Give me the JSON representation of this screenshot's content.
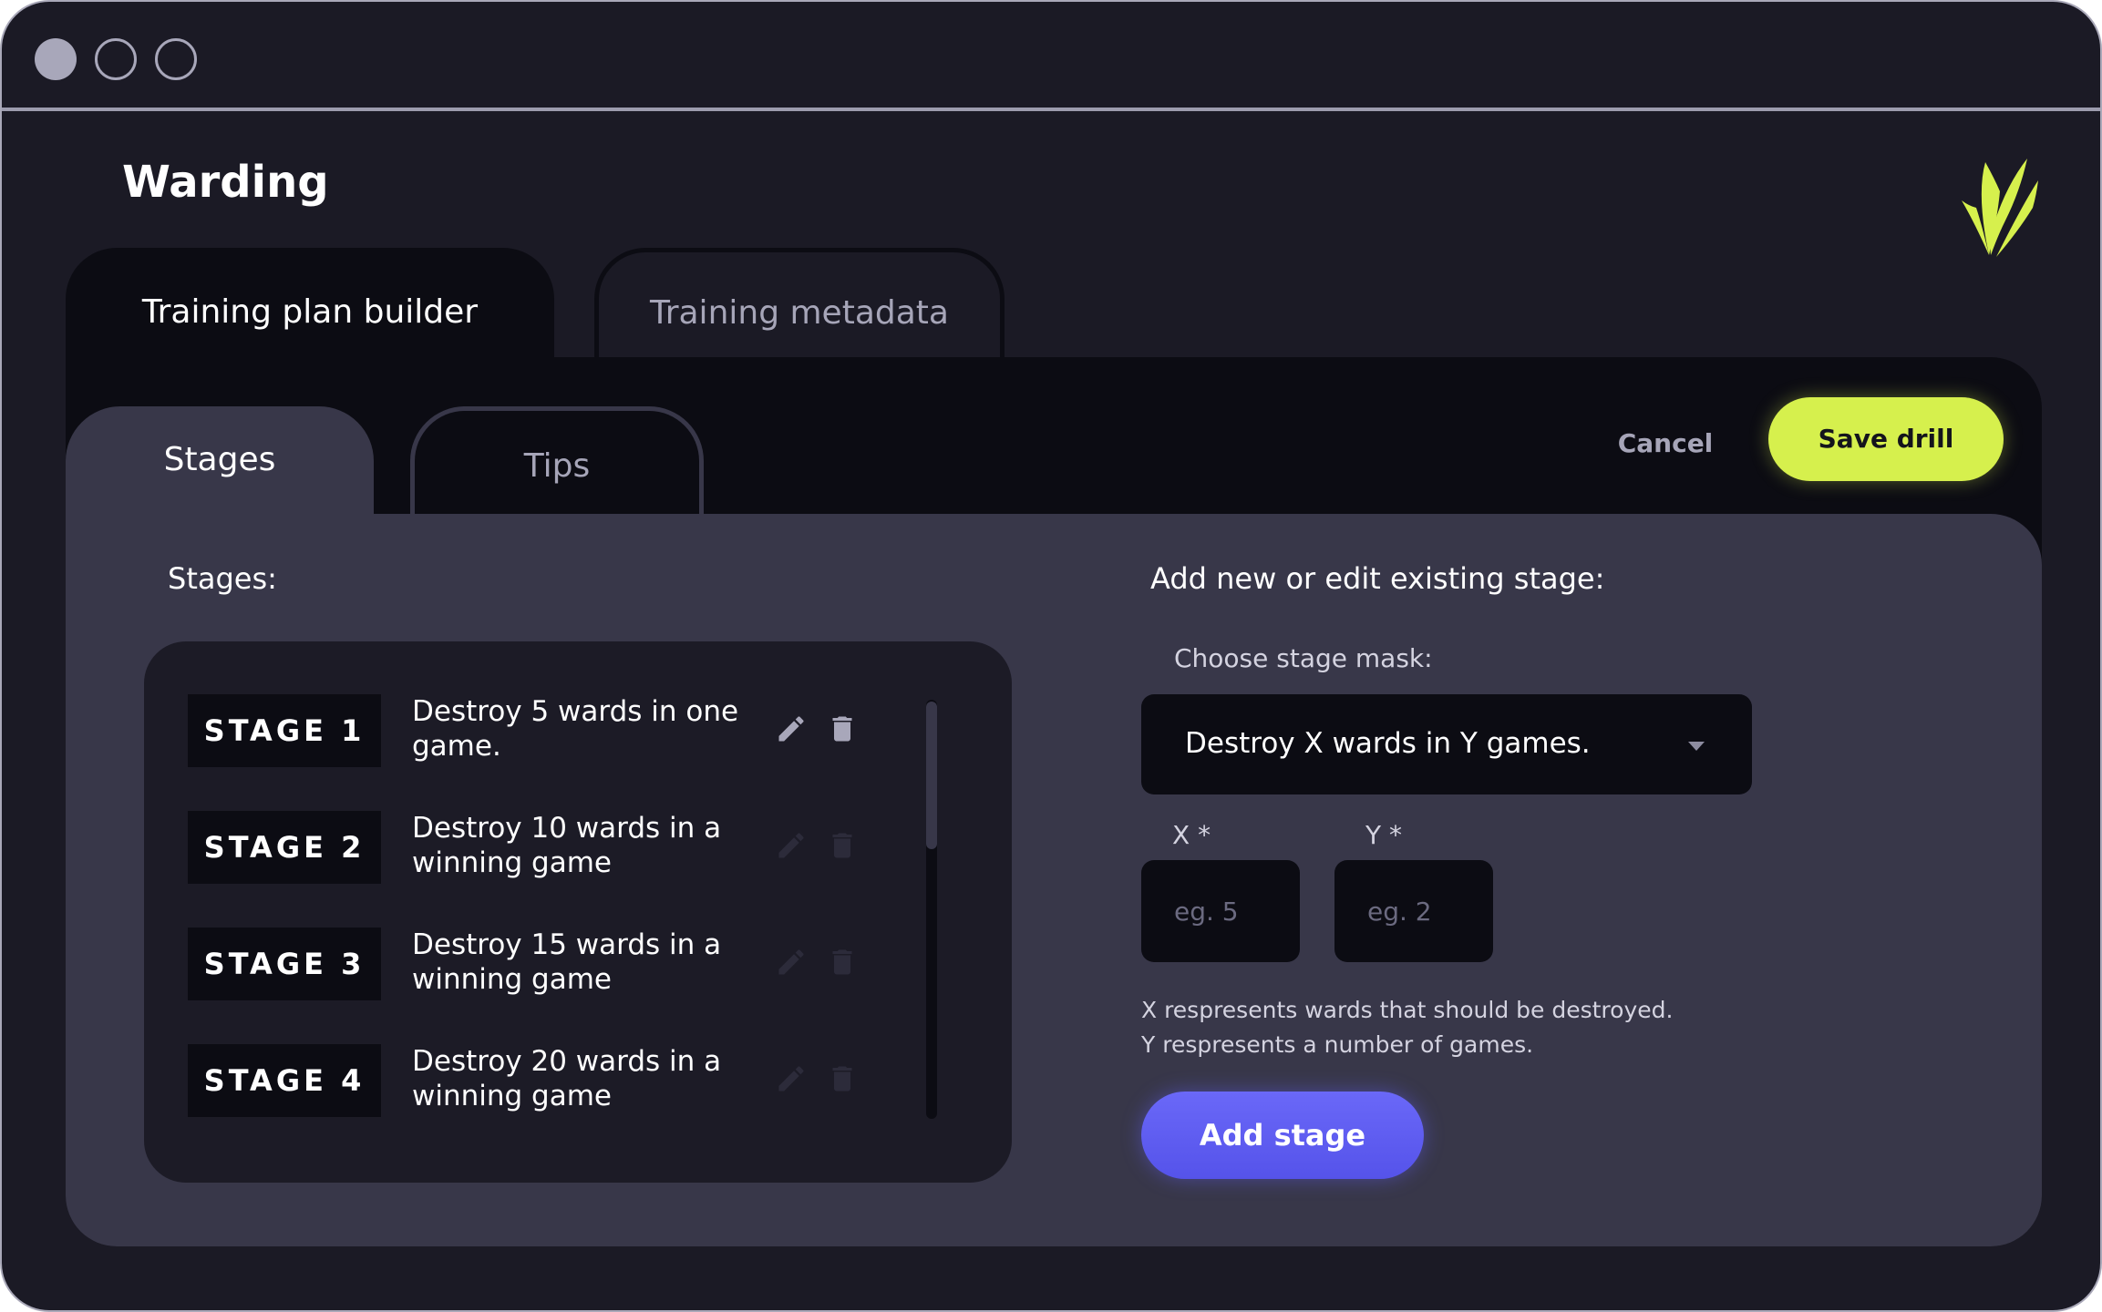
{
  "window": {
    "controls": [
      "close-dot",
      "minimize-dot",
      "maximize-dot"
    ]
  },
  "app": {
    "title": "Warding",
    "logo_icon": "grass-sprout-icon",
    "accent_color": "#d6f04d"
  },
  "main_tabs": [
    {
      "label": "Training plan builder",
      "active": true
    },
    {
      "label": "Training metadata",
      "active": false
    }
  ],
  "sub_tabs": [
    {
      "label": "Stages",
      "active": true
    },
    {
      "label": "Tips",
      "active": false
    }
  ],
  "actions": {
    "cancel_label": "Cancel",
    "save_label": "Save drill"
  },
  "stages": {
    "heading": "Stages:",
    "items": [
      {
        "badge": "STAGE 1",
        "text": "Destroy 5 wards in one game.",
        "edit_icon": "pencil-icon",
        "delete_icon": "trash-icon",
        "icons_enabled": true
      },
      {
        "badge": "STAGE 2",
        "text": "Destroy 10 wards in a winning game",
        "edit_icon": "pencil-icon",
        "delete_icon": "trash-icon",
        "icons_enabled": false
      },
      {
        "badge": "STAGE 3",
        "text": "Destroy 15 wards in a winning game",
        "edit_icon": "pencil-icon",
        "delete_icon": "trash-icon",
        "icons_enabled": false
      },
      {
        "badge": "STAGE 4",
        "text": "Destroy 20 wards in a winning game",
        "edit_icon": "pencil-icon",
        "delete_icon": "trash-icon",
        "icons_enabled": false
      }
    ]
  },
  "form": {
    "heading": "Add new or edit existing stage:",
    "mask_label": "Choose stage mask:",
    "mask_value": "Destroy X wards in Y games.",
    "x_label": "X *",
    "x_placeholder": "eg. 5",
    "y_label": "Y *",
    "y_placeholder": "eg. 2",
    "help_line_1": "X respresents wards that should be destroyed.",
    "help_line_2": "Y respresents a number of games.",
    "add_label": "Add stage",
    "add_color": "#5f5df2"
  }
}
